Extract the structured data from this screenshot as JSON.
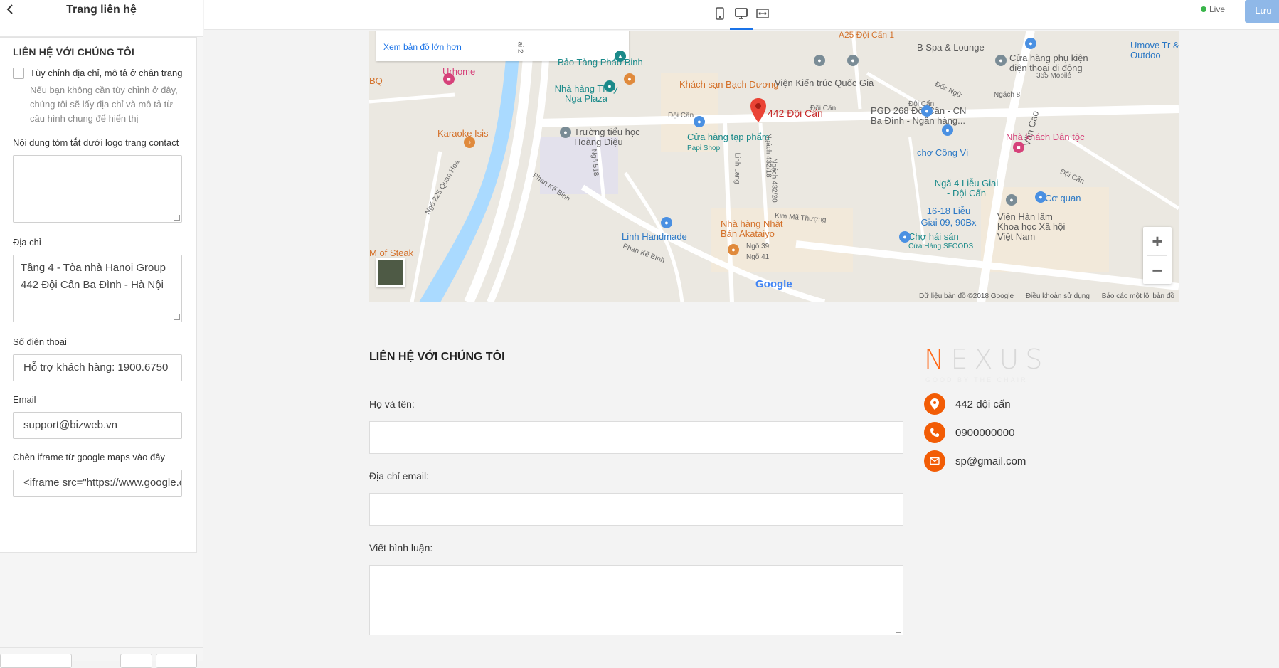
{
  "sidebar": {
    "back_icon": "chevron-left-icon",
    "title": "Trang liên hệ",
    "section_title": "LIÊN HỆ VỚI CHÚNG TÔI",
    "custom_checkbox_label": "Tùy chỉnh địa chỉ, mô tả ở chân trang",
    "custom_checkbox_help": "Nếu bạn không cần tùy chỉnh ở đây, chúng tôi sẽ lấy địa chỉ và mô tả từ cấu hình chung để hiển thị",
    "summary_label": "Nội dung tóm tắt dưới logo trang contact",
    "summary_value": "",
    "address_label": "Địa chỉ",
    "address_value": "Tầng 4 - Tòa nhà Hanoi Group 442 Đội Cấn Ba Đình - Hà Nội",
    "phone_label": "Số điện thoại",
    "phone_value": "Hỗ trợ khách hàng: 1900.6750",
    "email_label": "Email",
    "email_value": "support@bizweb.vn",
    "iframe_label": "Chèn iframe từ google maps vào đây",
    "iframe_value": "<iframe src=\"https://www.google.com/maps/embed"
  },
  "topbar": {
    "devices": [
      "mobile-icon",
      "desktop-icon",
      "fullwidth-icon"
    ],
    "active_device": "desktop-icon",
    "live_label": "Live",
    "save_label": "Lưu",
    "live_color": "#39b54a",
    "save_color": "#8fb8e8"
  },
  "map": {
    "larger_map_link": "Xem bản đồ lớn hơn",
    "marker_label": "442 Đội Cấn",
    "labels": {
      "a25": "A25 Đội Cấn 1",
      "bspa": "B Spa & Lounge",
      "umove": "Umove Tr & Outdoo",
      "baotang": "Bảo Tàng Pháo Binh",
      "cuahang_pk": "Cửa hàng phụ kiện điện thoại di động",
      "mobile365": "365 Mobile",
      "urhome": "Urhome",
      "bbq": "BQ",
      "thuy": "Nhà hàng Thúy Nga Plaza",
      "bachduong": "Khách sạn Bạch Dương",
      "kientruc": "Viện Kiến trúc Quốc Gia",
      "docngu": "Đốc Ngữ",
      "ngach8": "Ngách 8",
      "doican1": "Đội Cấn",
      "doican2": "Đội Cấn",
      "doican3": "Đội Cấn",
      "doican4": "Đội Cấn",
      "pgd": "PGD 268 Đội Cấn - CN Ba Đình - Ngân hàng...",
      "vancao": "Văn Cao",
      "karaoke": "Karaoke Isis",
      "hoangdieu": "Trường tiểu học Hoàng Diệu",
      "papi": "Cửa hàng tạp phẩm",
      "papi_sub": "Papi Shop",
      "congvi": "chợ Cống Vị",
      "nhakhach": "Nhà khách Dân tộc",
      "quanhoa": "Ngõ 225 Quan Hoa",
      "ngo518": "Ngõ 518",
      "linhlang": "Linh Lang",
      "ngach432_20": "Ngách 432/20",
      "ngach432_18": "Ngách 432/18",
      "nga4": "Ngã 4 Liễu Giai - Đội Cấn",
      "coquan": "Cơ quan",
      "phankebinh1": "Phan Kế Bính",
      "phankebinh2": "Phan Kế Bính",
      "kimma": "Kim Mã Thượng",
      "lieugiai": "16-18 Liễu Giai 09, 90Bx",
      "vienhan": "Viện Hàn lâm Khoa học Xã hội Việt Nam",
      "linhhandmade": "Linh Handmade",
      "akatai": "Nhà hàng Nhật Bản Akataiyo",
      "ngo39": "Ngõ 39",
      "ngo41": "Ngõ 41",
      "chohaisan": "Chợ hải sản",
      "sfoods": "Cửa Hàng SFOODS",
      "steak": "M   of Steak",
      "ngo2": "ai 2",
      "google": "Google"
    },
    "attribution": [
      "Dữ liệu bản đồ ©2018 Google",
      "Điều khoản sử dụng",
      "Báo cáo một lỗi bản đồ"
    ],
    "zoom_in": "+",
    "zoom_out": "−"
  },
  "form": {
    "title": "LIÊN HỆ VỚI CHÚNG TÔI",
    "name_label": "Họ và tên:",
    "email_label": "Địa chỉ email:",
    "comment_label": "Viết bình luận:"
  },
  "contact_info": {
    "brand_first": "N",
    "brand_rest": "EXUS",
    "brand_tagline": "GOOD BY THE CHAIR",
    "brand_color": "#ff6a1a",
    "icon_color": "#f25c05",
    "address": "442 đội cấn",
    "phone": "0900000000",
    "email": "sp@gmail.com",
    "icons": [
      "map-pin-icon",
      "phone-icon",
      "envelope-icon"
    ]
  }
}
